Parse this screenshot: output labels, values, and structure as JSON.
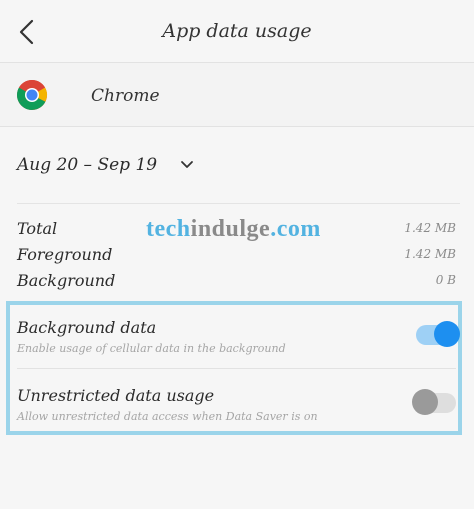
{
  "header": {
    "title": "App data usage"
  },
  "app": {
    "name": "Chrome"
  },
  "date_range": {
    "label": "Aug 20 – Sep 19"
  },
  "usage": [
    {
      "label": "Total",
      "value": "1.42 MB"
    },
    {
      "label": "Foreground",
      "value": "1.42 MB"
    },
    {
      "label": "Background",
      "value": "0 B"
    }
  ],
  "watermark": {
    "part1": "tech",
    "part2": "indulge",
    "part3": ".com"
  },
  "toggles": [
    {
      "title": "Background data",
      "description": "Enable usage of cellular data in the background",
      "on": true
    },
    {
      "title": "Unrestricted data usage",
      "description": "Allow unrestricted data access when Data Saver is on",
      "on": false
    }
  ],
  "colors": {
    "accent": "#1d8ff0",
    "highlight_border": "#9bd4ea"
  }
}
